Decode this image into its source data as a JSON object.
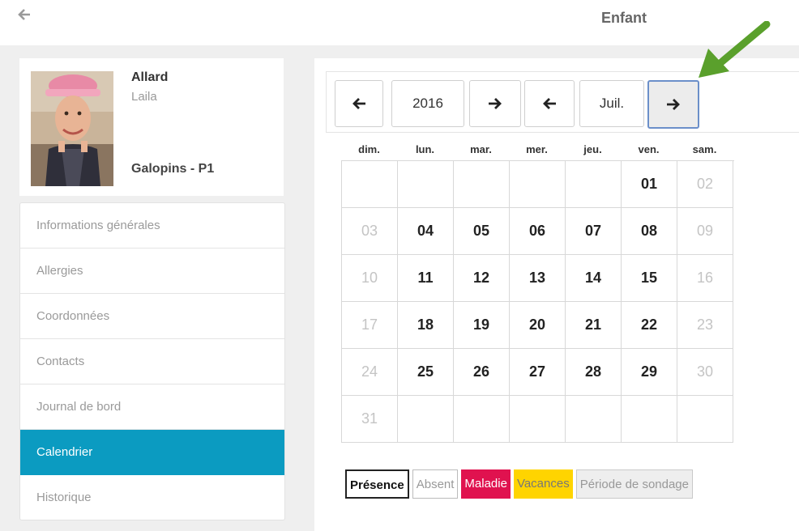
{
  "header": {
    "back_icon": "arrow-left-icon",
    "title": "Enfant"
  },
  "child": {
    "last_name": "Allard",
    "first_name": "Laila",
    "group": "Galopins - P1"
  },
  "menu": {
    "items": [
      {
        "label": "Informations générales",
        "active": false
      },
      {
        "label": "Allergies",
        "active": false
      },
      {
        "label": "Coordonnées",
        "active": false
      },
      {
        "label": "Contacts",
        "active": false
      },
      {
        "label": "Journal de bord",
        "active": false
      },
      {
        "label": "Calendrier",
        "active": true
      },
      {
        "label": "Historique",
        "active": false
      }
    ]
  },
  "calendar_nav": {
    "prev_icon": "arrow-left-icon",
    "next_icon": "arrow-right-icon",
    "year": "2016",
    "month": "Juil."
  },
  "calendar": {
    "weekdays": [
      "dim.",
      "lun.",
      "mar.",
      "mer.",
      "jeu.",
      "ven.",
      "sam."
    ],
    "weeks": [
      [
        "",
        "",
        "",
        "",
        "",
        "01",
        "02"
      ],
      [
        "03",
        "04",
        "05",
        "06",
        "07",
        "08",
        "09"
      ],
      [
        "10",
        "11",
        "12",
        "13",
        "14",
        "15",
        "16"
      ],
      [
        "17",
        "18",
        "19",
        "20",
        "21",
        "22",
        "23"
      ],
      [
        "24",
        "25",
        "26",
        "27",
        "28",
        "29",
        "30"
      ],
      [
        "31",
        "",
        "",
        "",
        "",
        "",
        ""
      ]
    ]
  },
  "legend": {
    "presence": "Présence",
    "absent": "Absent",
    "maladie": "Maladie",
    "vacances": "Vacances",
    "sondage": "Période de sondage"
  },
  "colors": {
    "accent": "#0b9bc1",
    "maladie": "#e0124f",
    "vacances": "#ffd400",
    "annotation_arrow": "#5aa02c"
  }
}
